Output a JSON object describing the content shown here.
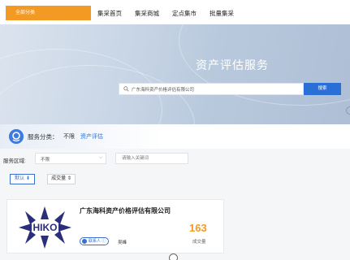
{
  "topnav": {
    "all_categories": "全部分类",
    "links": [
      "集采首页",
      "集采商城",
      "定点集市",
      "批量集采"
    ]
  },
  "banner": {
    "title": "资产评估服务",
    "search": {
      "value": "广东海科资产价格评估有限公司",
      "button": "搜索",
      "icon": "search-icon"
    }
  },
  "category": {
    "label": "服务分类：",
    "options": [
      "不限",
      "资产评估"
    ],
    "active_color": "#2a6fd6"
  },
  "filters": {
    "region_label": "服务区域:",
    "region_value": "不限",
    "keyword_placeholder": "请输入关键词"
  },
  "sort": {
    "default_label": "默认",
    "volume_label": "成交量"
  },
  "results": [
    {
      "company": "广东海科资产价格评估有限公司",
      "logo_text": "HIKO",
      "contact_tag": "联系人",
      "contact_name": "吴峰",
      "deal_count": "163",
      "deal_label": "成交量"
    }
  ],
  "colors": {
    "accent_orange": "#f39a25",
    "primary_blue": "#2a6fd6"
  }
}
